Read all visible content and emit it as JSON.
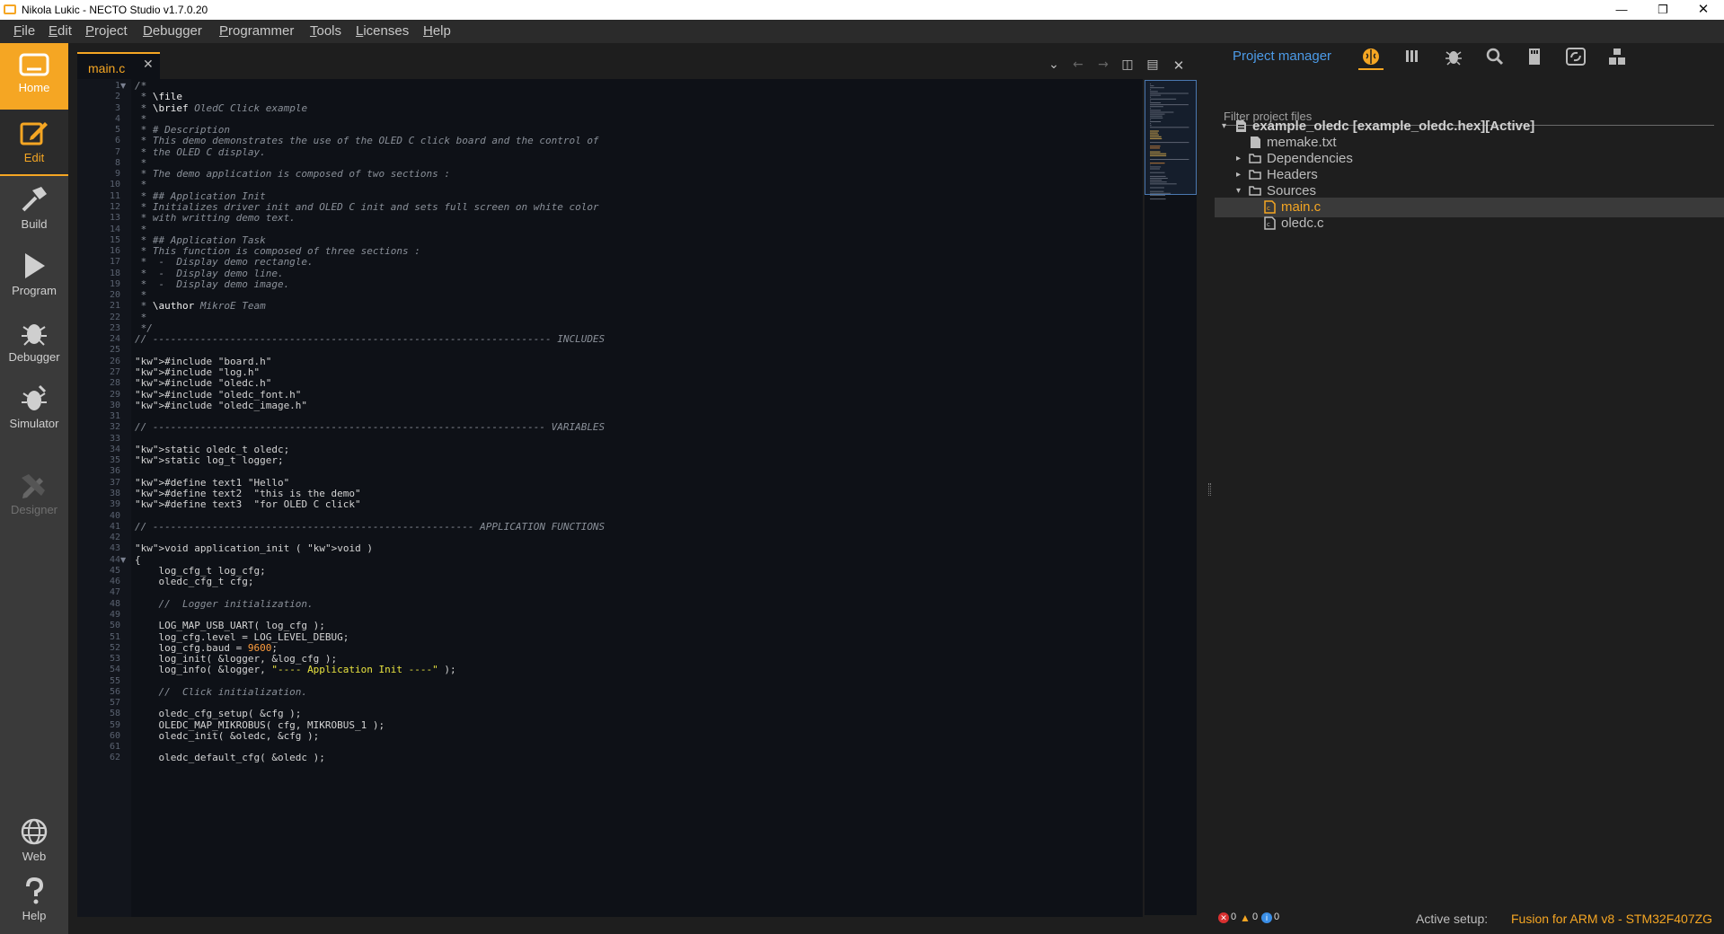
{
  "window": {
    "title": "Nikola Lukic - NECTO Studio v1.7.0.20"
  },
  "menu": [
    "File",
    "Edit",
    "Project",
    "Debugger",
    "Programmer",
    "Tools",
    "Licenses",
    "Help"
  ],
  "activity": {
    "home": "Home",
    "edit": "Edit",
    "build": "Build",
    "program": "Program",
    "debugger": "Debugger",
    "simulator": "Simulator",
    "designer": "Designer",
    "web": "Web",
    "help": "Help"
  },
  "editor": {
    "tab_label": "main.c",
    "lines": [
      {
        "n": 1,
        "t": "/*"
      },
      {
        "n": 2,
        "t": " * \\file"
      },
      {
        "n": 3,
        "t": " * \\brief OledC Click example"
      },
      {
        "n": 4,
        "t": " *"
      },
      {
        "n": 5,
        "t": " * # Description"
      },
      {
        "n": 6,
        "t": " * This demo demonstrates the use of the OLED C click board and the control of"
      },
      {
        "n": 7,
        "t": " * the OLED C display."
      },
      {
        "n": 8,
        "t": " *"
      },
      {
        "n": 9,
        "t": " * The demo application is composed of two sections :"
      },
      {
        "n": 10,
        "t": " *"
      },
      {
        "n": 11,
        "t": " * ## Application Init"
      },
      {
        "n": 12,
        "t": " * Initializes driver init and OLED C init and sets full screen on white color"
      },
      {
        "n": 13,
        "t": " * with writting demo text."
      },
      {
        "n": 14,
        "t": " *"
      },
      {
        "n": 15,
        "t": " * ## Application Task"
      },
      {
        "n": 16,
        "t": " * This function is composed of three sections :"
      },
      {
        "n": 17,
        "t": " *  -  Display demo rectangle."
      },
      {
        "n": 18,
        "t": " *  -  Display demo line."
      },
      {
        "n": 19,
        "t": " *  -  Display demo image."
      },
      {
        "n": 20,
        "t": " *"
      },
      {
        "n": 21,
        "t": " * \\author MikroE Team"
      },
      {
        "n": 22,
        "t": " *"
      },
      {
        "n": 23,
        "t": " */"
      },
      {
        "n": 24,
        "t": "// ------------------------------------------------------------------- INCLUDES"
      },
      {
        "n": 25,
        "t": ""
      },
      {
        "n": 26,
        "t": "#include \"board.h\""
      },
      {
        "n": 27,
        "t": "#include \"log.h\""
      },
      {
        "n": 28,
        "t": "#include \"oledc.h\""
      },
      {
        "n": 29,
        "t": "#include \"oledc_font.h\""
      },
      {
        "n": 30,
        "t": "#include \"oledc_image.h\""
      },
      {
        "n": 31,
        "t": ""
      },
      {
        "n": 32,
        "t": "// ------------------------------------------------------------------ VARIABLES"
      },
      {
        "n": 33,
        "t": ""
      },
      {
        "n": 34,
        "t": "static oledc_t oledc;"
      },
      {
        "n": 35,
        "t": "static log_t logger;"
      },
      {
        "n": 36,
        "t": ""
      },
      {
        "n": 37,
        "t": "#define text1 \"Hello\""
      },
      {
        "n": 38,
        "t": "#define text2  \"this is the demo\""
      },
      {
        "n": 39,
        "t": "#define text3  \"for OLED C click\""
      },
      {
        "n": 40,
        "t": ""
      },
      {
        "n": 41,
        "t": "// ------------------------------------------------------ APPLICATION FUNCTIONS"
      },
      {
        "n": 42,
        "t": ""
      },
      {
        "n": 43,
        "t": "void application_init ( void )"
      },
      {
        "n": 44,
        "t": "{"
      },
      {
        "n": 45,
        "t": "    log_cfg_t log_cfg;"
      },
      {
        "n": 46,
        "t": "    oledc_cfg_t cfg;"
      },
      {
        "n": 47,
        "t": ""
      },
      {
        "n": 48,
        "t": "    //  Logger initialization."
      },
      {
        "n": 49,
        "t": ""
      },
      {
        "n": 50,
        "t": "    LOG_MAP_USB_UART( log_cfg );"
      },
      {
        "n": 51,
        "t": "    log_cfg.level = LOG_LEVEL_DEBUG;"
      },
      {
        "n": 52,
        "t": "    log_cfg.baud = 9600;"
      },
      {
        "n": 53,
        "t": "    log_init( &logger, &log_cfg );"
      },
      {
        "n": 54,
        "t": "    log_info( &logger, \"---- Application Init ----\" );"
      },
      {
        "n": 55,
        "t": ""
      },
      {
        "n": 56,
        "t": "    //  Click initialization."
      },
      {
        "n": 57,
        "t": ""
      },
      {
        "n": 58,
        "t": "    oledc_cfg_setup( &cfg );"
      },
      {
        "n": 59,
        "t": "    OLEDC_MAP_MIKROBUS( cfg, MIKROBUS_1 );"
      },
      {
        "n": 60,
        "t": "    oledc_init( &oledc, &cfg );"
      },
      {
        "n": 61,
        "t": ""
      },
      {
        "n": 62,
        "t": "    oledc_default_cfg( &oledc );"
      }
    ]
  },
  "project": {
    "title": "Project manager",
    "filter_placeholder": "Filter project files",
    "tree": [
      {
        "label": "example_oledc [example_oledc.hex][Active]",
        "level": 0,
        "arrow": "▾",
        "icon": "project-icon",
        "bold": true
      },
      {
        "label": "memake.txt",
        "level": 1,
        "arrow": "",
        "icon": "file-icon"
      },
      {
        "label": "Dependencies",
        "level": 1,
        "arrow": "▸",
        "icon": "folder-icon"
      },
      {
        "label": "Headers",
        "level": 1,
        "arrow": "▸",
        "icon": "folder-icon"
      },
      {
        "label": "Sources",
        "level": 1,
        "arrow": "▾",
        "icon": "folder-icon"
      },
      {
        "label": "main.c",
        "level": 2,
        "arrow": "",
        "icon": "c-file-icon",
        "selected": true
      },
      {
        "label": "oledc.c",
        "level": 2,
        "arrow": "",
        "icon": "c-file-icon"
      }
    ]
  },
  "status": {
    "errors": "0",
    "warnings": "0",
    "infos": "0",
    "active_label": "Active setup:",
    "active_value": "Fusion for ARM v8 - STM32F407ZG"
  },
  "colors": {
    "accent": "#f5a623",
    "link": "#4c9be8",
    "editor_bg": "#0e1117"
  }
}
